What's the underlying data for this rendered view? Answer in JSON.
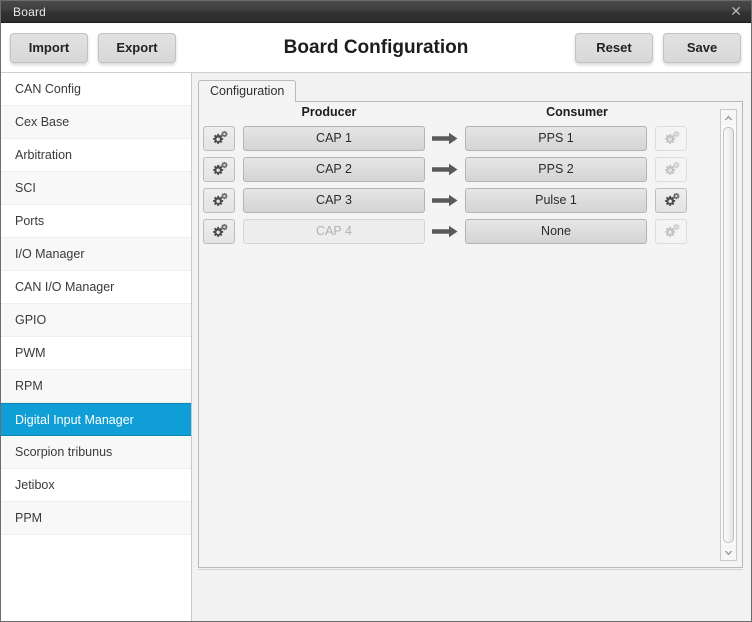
{
  "window": {
    "title": "Board",
    "close_icon": "close-icon"
  },
  "header": {
    "title": "Board Configuration",
    "import_label": "Import",
    "export_label": "Export",
    "reset_label": "Reset",
    "save_label": "Save"
  },
  "sidebar": {
    "items": [
      {
        "label": "CAN Config",
        "active": false
      },
      {
        "label": "Cex Base",
        "active": false
      },
      {
        "label": "Arbitration",
        "active": false
      },
      {
        "label": "SCI",
        "active": false
      },
      {
        "label": "Ports",
        "active": false
      },
      {
        "label": "I/O Manager",
        "active": false
      },
      {
        "label": "CAN I/O Manager",
        "active": false
      },
      {
        "label": "GPIO",
        "active": false
      },
      {
        "label": "PWM",
        "active": false
      },
      {
        "label": "RPM",
        "active": false
      },
      {
        "label": "Digital Input Manager",
        "active": true
      },
      {
        "label": "Scorpion tribunus",
        "active": false
      },
      {
        "label": "Jetibox",
        "active": false
      },
      {
        "label": "PPM",
        "active": false
      }
    ],
    "active_label": "Digital Input Manager",
    "active_color": "#0f9ed5"
  },
  "main": {
    "tabs": [
      {
        "label": "Configuration",
        "active": true
      }
    ],
    "columns": {
      "producer": "Producer",
      "consumer": "Consumer"
    },
    "rows": [
      {
        "left_gear_icon": "gears-settings-icon",
        "left_gear_enabled": true,
        "producer": "CAP 1",
        "producer_enabled": true,
        "arrow_icon": "arrow-right-icon",
        "consumer": "PPS 1",
        "consumer_enabled": true,
        "right_gear_icon": "gears-settings-icon",
        "right_gear_enabled": false
      },
      {
        "left_gear_icon": "gears-settings-icon",
        "left_gear_enabled": true,
        "producer": "CAP 2",
        "producer_enabled": true,
        "arrow_icon": "arrow-right-icon",
        "consumer": "PPS 2",
        "consumer_enabled": true,
        "right_gear_icon": "gears-settings-icon",
        "right_gear_enabled": false
      },
      {
        "left_gear_icon": "gears-settings-icon",
        "left_gear_enabled": true,
        "producer": "CAP 3",
        "producer_enabled": true,
        "arrow_icon": "arrow-right-icon",
        "consumer": "Pulse 1",
        "consumer_enabled": true,
        "right_gear_icon": "gears-settings-icon",
        "right_gear_enabled": true
      },
      {
        "left_gear_icon": "gears-settings-icon",
        "left_gear_enabled": true,
        "producer": "CAP 4",
        "producer_enabled": false,
        "arrow_icon": "arrow-right-icon",
        "consumer": "None",
        "consumer_enabled": true,
        "right_gear_icon": "gears-settings-icon",
        "right_gear_enabled": false
      }
    ],
    "scrollbar": {
      "up_icon": "chevron-up-icon",
      "down_icon": "chevron-down-icon"
    }
  }
}
